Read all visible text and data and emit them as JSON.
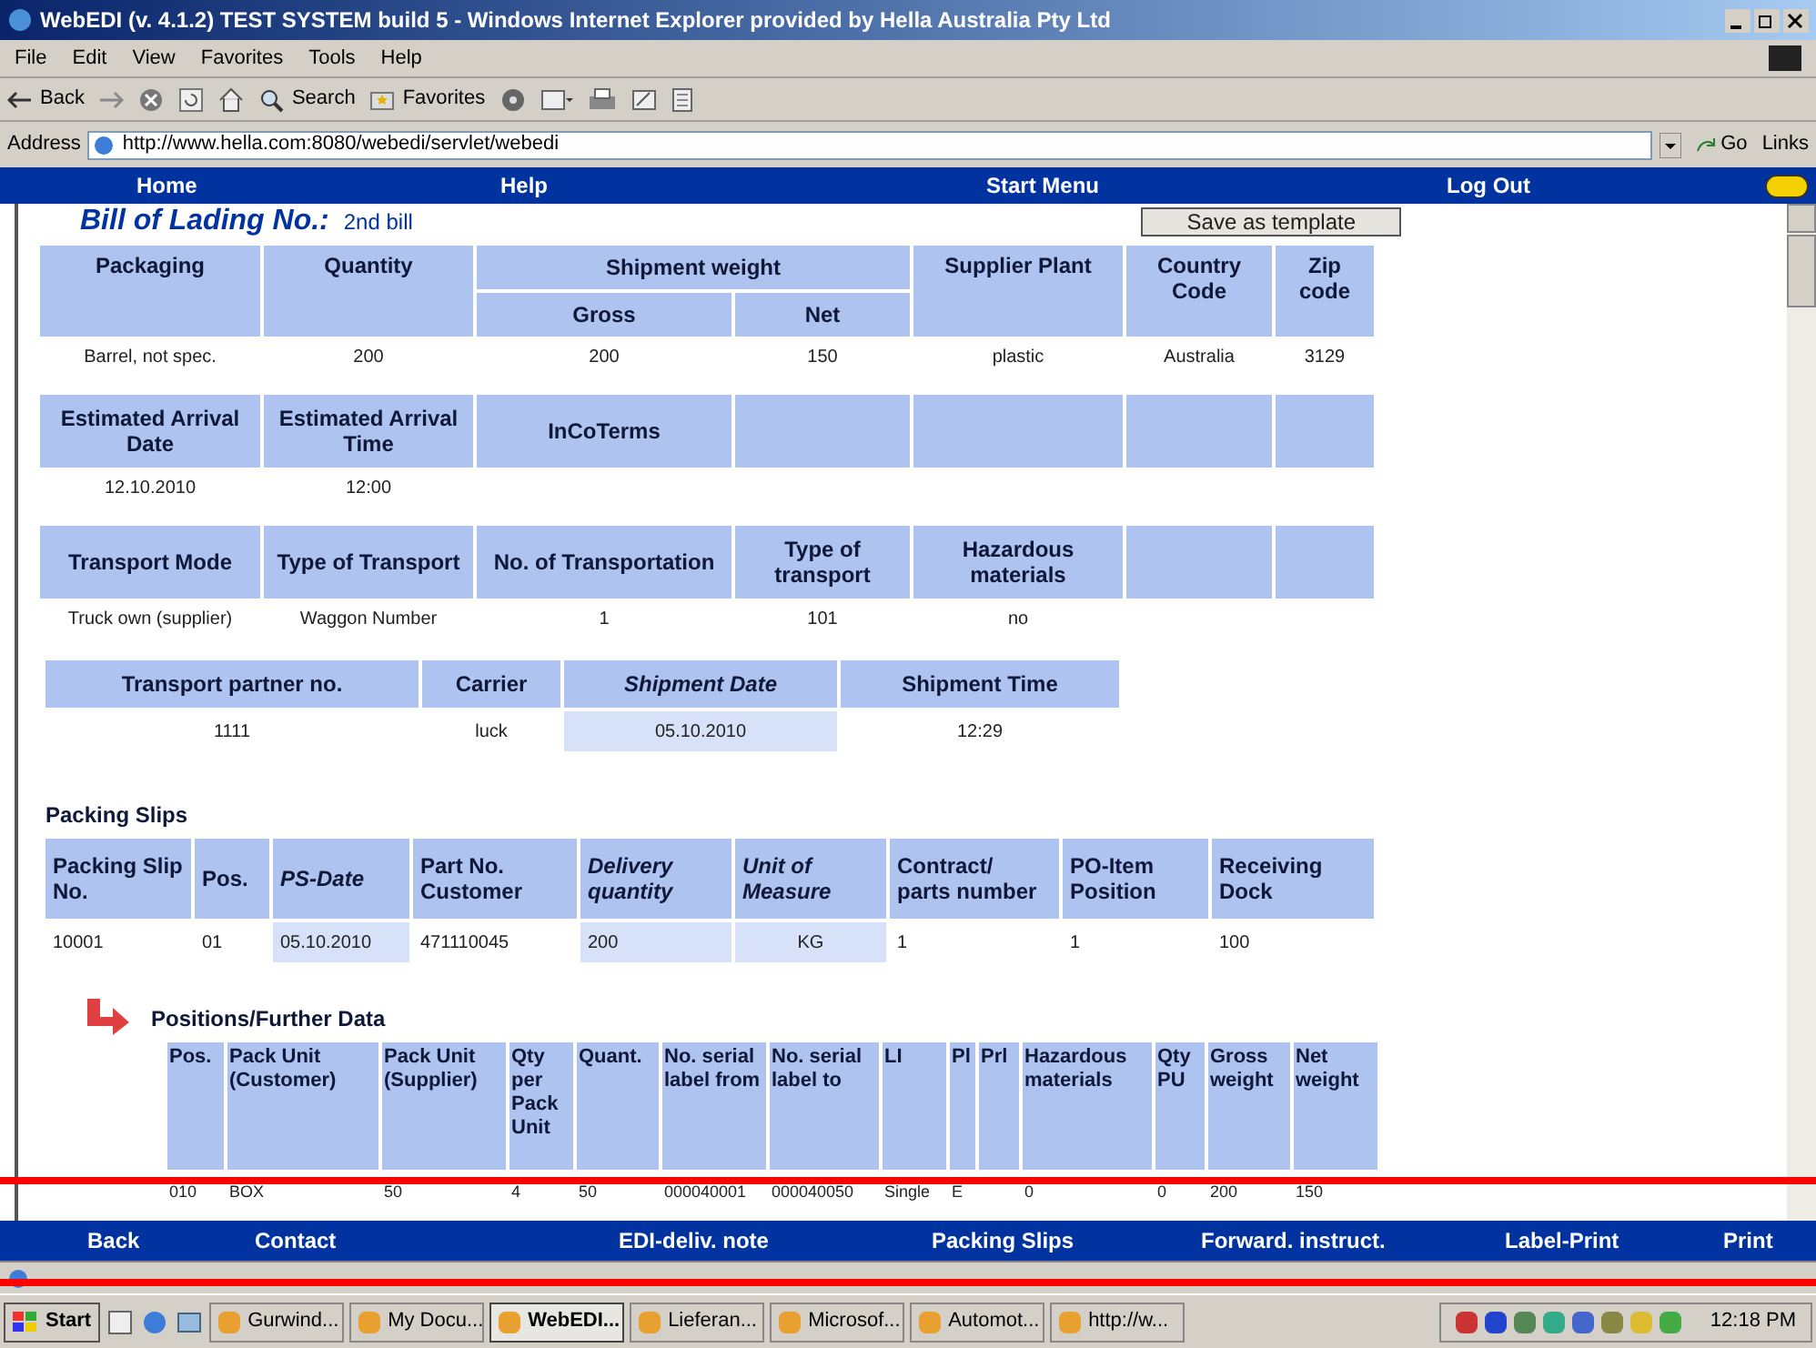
{
  "window": {
    "title": "WebEDI (v. 4.1.2) TEST SYSTEM build 5 - Windows Internet Explorer provided by Hella Australia Pty Ltd"
  },
  "menu": [
    "File",
    "Edit",
    "View",
    "Favorites",
    "Tools",
    "Help"
  ],
  "toolbar": [
    {
      "label": "Back",
      "kind": "back"
    },
    {
      "kind": "forward"
    },
    {
      "kind": "stop"
    },
    {
      "kind": "refresh"
    },
    {
      "kind": "home"
    },
    {
      "label": "Search",
      "kind": "search"
    },
    {
      "label": "Favorites",
      "kind": "favorites"
    },
    {
      "kind": "media"
    },
    {
      "kind": "mail"
    },
    {
      "kind": "print"
    },
    {
      "kind": "edit"
    },
    {
      "kind": "discuss"
    }
  ],
  "address": {
    "label": "Address",
    "url": "http://www.hella.com:8080/webedi/servlet/webedi",
    "go": "Go",
    "links": "Links"
  },
  "nav": [
    "Home",
    "Help",
    "Start Menu",
    "Log Out"
  ],
  "bill": {
    "label": "Bill of Lading No.:",
    "value": "2nd bill"
  },
  "save_button": "Save as template",
  "shipment_table": {
    "group": "Shipment weight",
    "columns": [
      {
        "label": "Packaging",
        "kind": "plain"
      },
      {
        "label": "Quantity",
        "kind": "plain"
      },
      {
        "label": "Gross",
        "kind": "sub"
      },
      {
        "label": "Net",
        "kind": "sub"
      },
      {
        "label": "Supplier Plant",
        "kind": "plain"
      },
      {
        "label": "Country Code",
        "kind": "plain"
      },
      {
        "label": "Zip code",
        "kind": "plain"
      }
    ],
    "values": [
      "Barrel, not spec.",
      "200",
      "200",
      "150",
      "plastic",
      "Australia",
      "3129"
    ]
  },
  "arrival_table": {
    "columns": [
      "Estimated Arrival Date",
      "Estimated Arrival Time",
      "InCoTerms"
    ],
    "values": [
      "12.10.2010",
      "12:00"
    ]
  },
  "transport_table": {
    "columns": [
      "Transport Mode",
      "Type of Transport",
      "No. of Transportation",
      "Type of transport",
      "Hazardous materials"
    ],
    "values": [
      "Truck own (supplier)",
      "Waggon Number",
      "1",
      "101",
      "no"
    ]
  },
  "partner_table": {
    "columns": [
      {
        "label": "Transport partner no.",
        "editable": false
      },
      {
        "label": "Carrier",
        "editable": false
      },
      {
        "label": "Shipment Date",
        "editable": true
      },
      {
        "label": "Shipment Time",
        "editable": false
      }
    ],
    "values": [
      "1111",
      "luck",
      "05.10.2010",
      "12:29"
    ]
  },
  "packing_slips": {
    "title": "Packing Slips",
    "columns": [
      {
        "label": "Packing Slip No.",
        "editable": false
      },
      {
        "label": "Pos.",
        "editable": false
      },
      {
        "label": "PS-Date",
        "editable": true
      },
      {
        "label": "Part No. Customer",
        "editable": false
      },
      {
        "label": "Delivery quantity",
        "editable": true
      },
      {
        "label": "Unit of Measure",
        "editable": true
      },
      {
        "label": "Contract/ parts number",
        "editable": false
      },
      {
        "label": "PO-Item Position",
        "editable": false
      },
      {
        "label": "Receiving Dock",
        "editable": false
      }
    ],
    "values": [
      "10001",
      "01",
      "05.10.2010",
      "471110045",
      "200",
      "KG",
      "1",
      "1",
      "100"
    ]
  },
  "positions": {
    "title": "Positions/Further Data",
    "columns": [
      {
        "label": "Pos.",
        "value": "010"
      },
      {
        "label": "Pack Unit (Customer)",
        "value": "BOX"
      },
      {
        "label": "Pack Unit (Supplier)",
        "value": "50"
      },
      {
        "label": "Qty per Pack Unit",
        "value": "4"
      },
      {
        "label": "Quant.",
        "value": "50"
      },
      {
        "label": "No. serial label from",
        "value": "000040001"
      },
      {
        "label": "No. serial label to",
        "value": "000040050"
      },
      {
        "label": "LI",
        "value": "Single"
      },
      {
        "label": "Pl",
        "value": "E"
      },
      {
        "label": "Prl"
      },
      {
        "label": "Hazardous materials",
        "value": "0"
      },
      {
        "label": "Qty PU",
        "value": "0"
      },
      {
        "label": "Gross weight",
        "value": "200"
      },
      {
        "label": "Net weight",
        "value": "150"
      }
    ]
  },
  "bottom_nav": [
    "Back",
    "Contact",
    "EDI-deliv. note",
    "Packing Slips",
    "Forward. instruct.",
    "Label-Print",
    "Print"
  ],
  "taskbar": {
    "start": "Start",
    "items": [
      {
        "label": "Gurwind...",
        "selected": false
      },
      {
        "label": "My Docu...",
        "selected": false
      },
      {
        "label": "WebEDI...",
        "selected": true
      },
      {
        "label": "Lieferan...",
        "selected": false
      },
      {
        "label": "Microsof...",
        "selected": false
      },
      {
        "label": "Automot...",
        "selected": false
      },
      {
        "label": "http://w...",
        "selected": false
      }
    ],
    "time": "12:18 PM"
  }
}
